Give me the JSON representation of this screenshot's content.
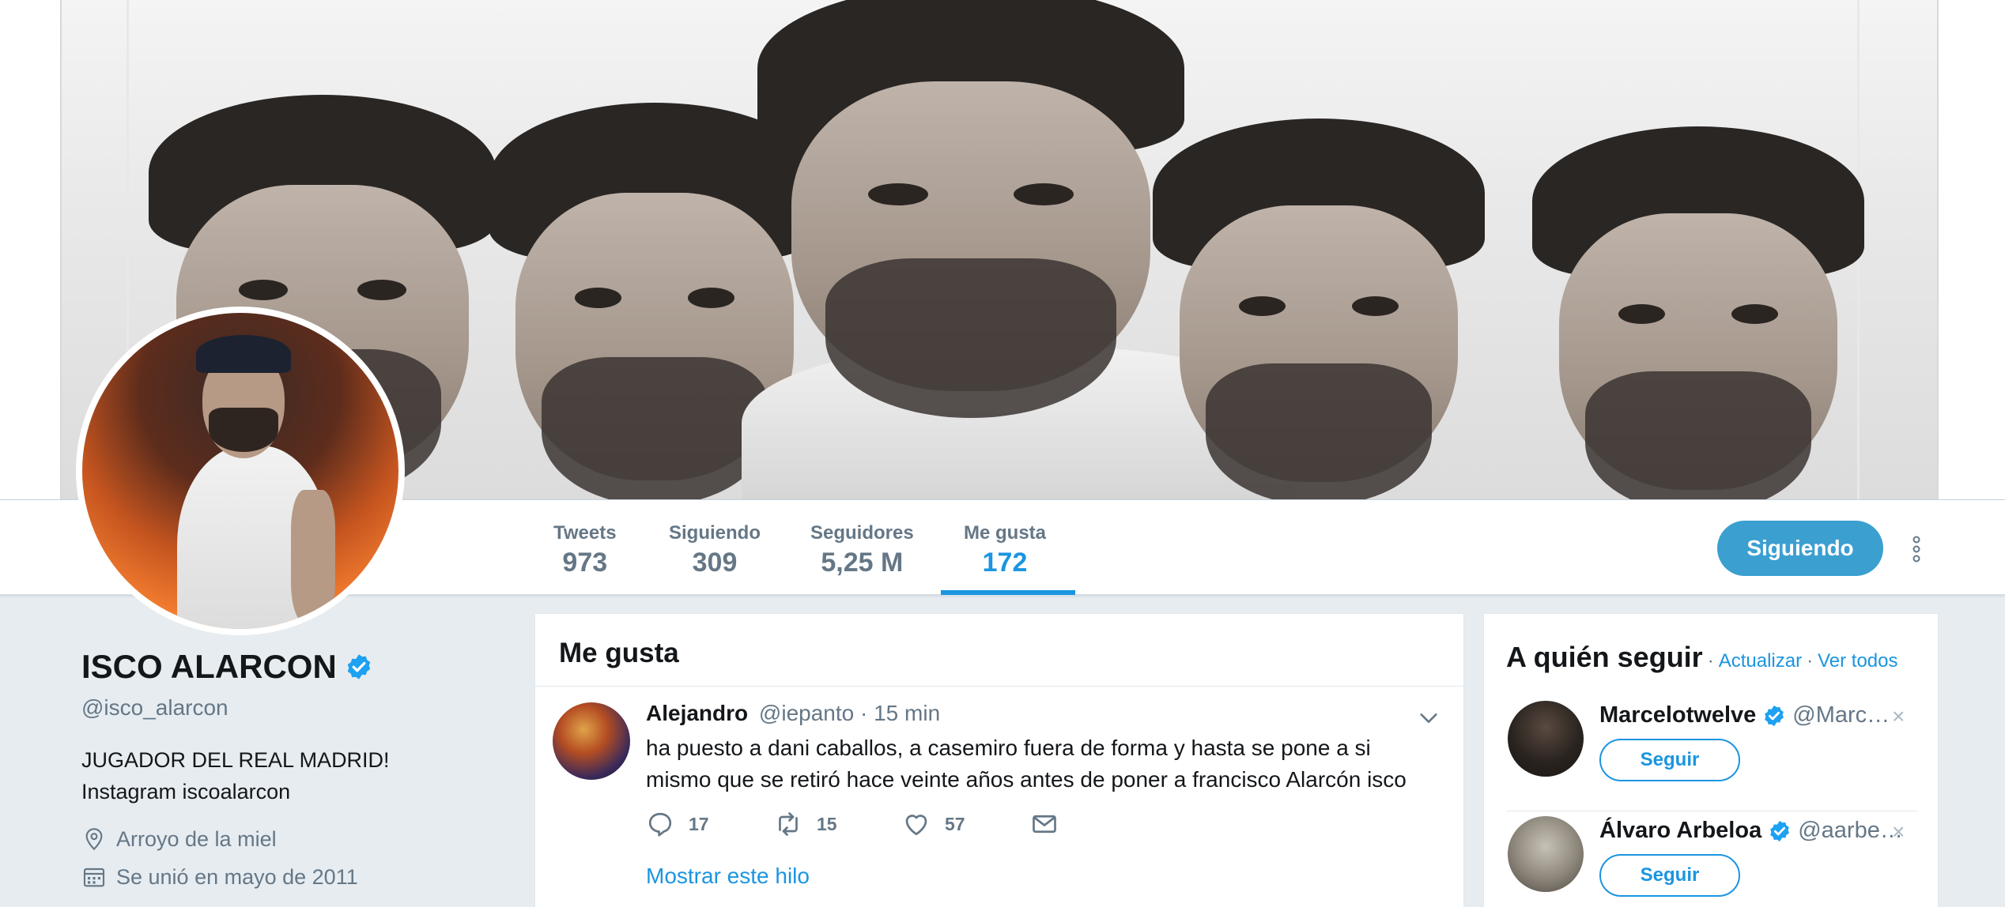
{
  "profile": {
    "name": "ISCO ALARCON",
    "handle": "@isco_alarcon",
    "bio_line1": "JUGADOR DEL REAL MADRID!",
    "bio_line2": "Instagram iscoalarcon",
    "location": "Arroyo de la miel",
    "joined": "Se unió en mayo de 2011"
  },
  "stats": [
    {
      "label": "Tweets",
      "value": "973"
    },
    {
      "label": "Siguiendo",
      "value": "309"
    },
    {
      "label": "Seguidores",
      "value": "5,25 M"
    },
    {
      "label": "Me gusta",
      "value": "172"
    }
  ],
  "follow_button": "Siguiendo",
  "timeline": {
    "title": "Me gusta",
    "tweet": {
      "author": "Alejandro",
      "handle": "@iepanto",
      "time": "· 15 min",
      "text_line1": "ha puesto a dani caballos, a casemiro fuera de forma y hasta se pone a si",
      "text_line2": "mismo que se retiró hace veinte años antes de poner a francisco Alarcón isco",
      "replies": "17",
      "retweets": "15",
      "likes": "57",
      "show_thread": "Mostrar este hilo"
    }
  },
  "who_to_follow": {
    "title": "A quién seguir",
    "sep": "·",
    "refresh": "Actualizar",
    "see_all": "Ver todos",
    "users": [
      {
        "name": "Marcelotwelve",
        "handle": "@Marc…",
        "button": "Seguir",
        "close": "×"
      },
      {
        "name": "Álvaro Arbeloa",
        "handle": "@aarbe…",
        "button": "Seguir",
        "close": "×"
      }
    ]
  },
  "colors": {
    "accent": "#1b95e0",
    "follow_bg": "#3b9fd0",
    "muted": "#657786",
    "page_bg": "#e6ecf0"
  }
}
